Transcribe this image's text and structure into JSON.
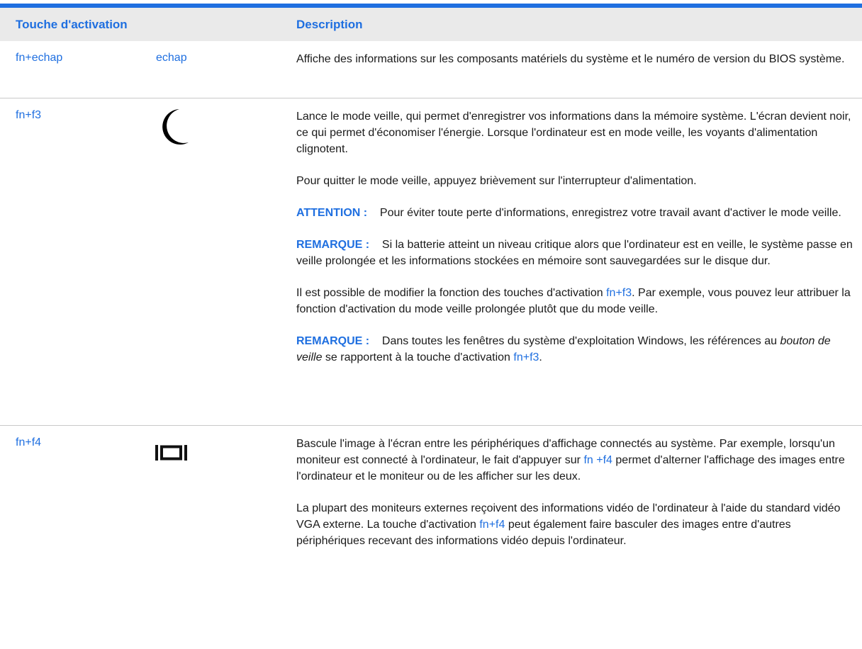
{
  "header": {
    "col_key": "Touche d'activation",
    "col_desc": "Description"
  },
  "row1": {
    "key": "fn+echap",
    "alt": "echap",
    "desc": "Affiche des informations sur les composants matériels du système et le numéro de version du BIOS système."
  },
  "row2": {
    "key": "fn+f3",
    "icon": "moon-icon",
    "p1": "Lance le mode veille, qui permet d'enregistrer vos informations dans la mémoire système. L'écran devient noir, ce qui permet d'économiser l'énergie. Lorsque l'ordinateur est en mode veille, les voyants d'alimentation clignotent.",
    "p2": "Pour quitter le mode veille, appuyez brièvement sur l'interrupteur d'alimentation.",
    "p3_label": "ATTENTION :",
    "p3_text": "Pour éviter toute perte d'informations, enregistrez votre travail avant d'activer le mode veille.",
    "p4_label": "REMARQUE :",
    "p4_text": "Si la batterie atteint un niveau critique alors que l'ordinateur est en veille, le système passe en veille prolongée et les informations stockées en mémoire sont sauvegardées sur le disque dur.",
    "p5_a": "Il est possible de modifier la fonction des touches d'activation",
    "p5_link": "fn+f3",
    "p5_b": ". Par exemple, vous pouvez leur attribuer la fonction d'activation du mode veille prolongée plutôt que du mode veille.",
    "p6_label": "REMARQUE :",
    "p6_a": "Dans toutes les fenêtres du système d'exploitation Windows, les références au",
    "p6_em": "bouton de veille",
    "p6_b": "se rapportent à la touche d'activation",
    "p6_link": "fn+f3",
    "p6_c": "."
  },
  "row3": {
    "key": "fn+f4",
    "icon": "display-switch-icon",
    "p1_a": "Bascule l'image à l'écran entre les périphériques d'affichage connectés au système. Par exemple, lorsqu'un moniteur est connecté à l'ordinateur, le fait d'appuyer sur",
    "p1_link": "fn +f4",
    "p1_b": "permet d'alterner l'affichage des images entre l'ordinateur et le moniteur ou de les afficher sur les deux.",
    "p2_a": "La plupart des moniteurs externes reçoivent des informations vidéo de l'ordinateur à l'aide du standard vidéo VGA externe. La touche d'activation",
    "p2_link": "fn+f4",
    "p2_b": "peut également faire basculer des images entre d'autres périphériques recevant des informations vidéo depuis l'ordinateur."
  },
  "colors": {
    "accent": "#1f6fe0",
    "header_bg": "#eaeaea",
    "rule": "#c9c9c9"
  }
}
